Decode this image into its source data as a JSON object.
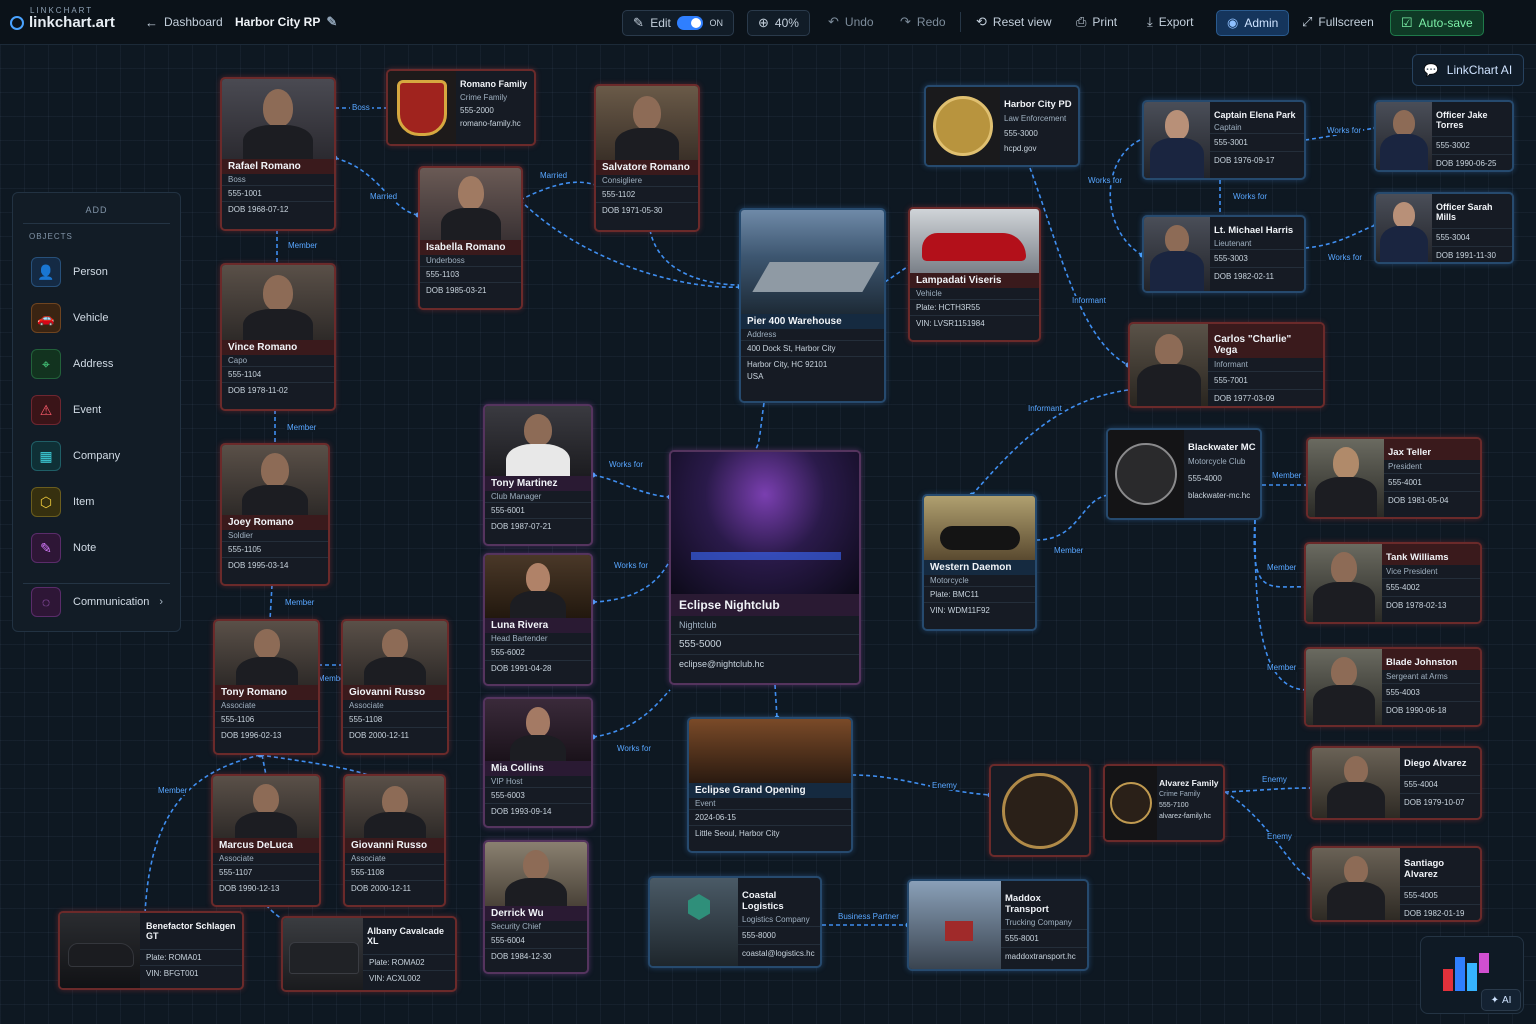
{
  "brand": {
    "small": "LINKCHART",
    "name": "linkchart.art"
  },
  "topbar": {
    "dashboard": "Dashboard",
    "project": "Harbor City RP",
    "edit": "Edit",
    "edit_state": "ON",
    "zoom": "40%",
    "undo": "Undo",
    "redo": "Redo",
    "reset": "Reset view",
    "print": "Print",
    "export": "Export",
    "admin": "Admin",
    "fullscreen": "Fullscreen",
    "autosave": "Auto-save"
  },
  "ai_button": "LinkChart AI",
  "ai_corner": "AI",
  "panel": {
    "title": "ADD",
    "section": "OBJECTS",
    "items": [
      "Person",
      "Vehicle",
      "Address",
      "Event",
      "Company",
      "Item",
      "Note",
      "Communication"
    ]
  },
  "colors": {
    "link": "#58a6ff",
    "red": "#6b2a2a",
    "blue": "#264a6e",
    "purple": "#55345e"
  },
  "links": [
    "Boss",
    "Married",
    "Married",
    "Member",
    "Member",
    "Member",
    "Member",
    "Member",
    "Works for",
    "Works for",
    "Works for",
    "Works for",
    "Works for",
    "Works for",
    "Informant",
    "Informant",
    "Member",
    "Member",
    "Member",
    "Member",
    "Enemy",
    "Enemy",
    "Enemy",
    "Business Partner"
  ],
  "cards": {
    "rafael": {
      "title": "Rafael Romano",
      "sub": "Boss",
      "phone": "555-1001",
      "dob": "DOB 1968-07-12"
    },
    "romanofam": {
      "title": "Romano Family",
      "sub": "Crime Family",
      "phone": "555-2000",
      "web": "romano-family.hc"
    },
    "salvatore": {
      "title": "Salvatore Romano",
      "sub": "Consigliere",
      "phone": "555-1102",
      "dob": "DOB 1971-05-30"
    },
    "isabella": {
      "title": "Isabella Romano",
      "sub": "Underboss",
      "phone": "555-1103",
      "dob": "DOB 1985-03-21"
    },
    "vince": {
      "title": "Vince Romano",
      "sub": "Capo",
      "phone": "555-1104",
      "dob": "DOB 1978-11-02"
    },
    "joey": {
      "title": "Joey Romano",
      "sub": "Soldier",
      "phone": "555-1105",
      "dob": "DOB 1995-03-14"
    },
    "tonyr": {
      "title": "Tony Romano",
      "sub": "Associate",
      "phone": "555-1106",
      "dob": "DOB 1996-02-13"
    },
    "giovanni1": {
      "title": "Giovanni Russo",
      "sub": "Associate",
      "phone": "555-1108",
      "dob": "DOB 2000-12-11"
    },
    "marcus": {
      "title": "Marcus DeLuca",
      "sub": "Associate",
      "phone": "555-1107",
      "dob": "DOB 1990-12-13"
    },
    "giovanni2": {
      "title": "Giovanni Russo",
      "sub": "Associate",
      "phone": "555-1108",
      "dob": "DOB 2000-12-11"
    },
    "benefactor": {
      "title": "Benefactor Schlagen GT",
      "plate": "Plate: ROMA01",
      "vin": "VIN: BFGT001"
    },
    "albany": {
      "title": "Albany Cavalcade XL",
      "plate": "Plate: ROMA02",
      "vin": "VIN: ACXL002"
    },
    "pier": {
      "title": "Pier 400 Warehouse",
      "sub": "Address",
      "l1": "400 Dock St, Harbor City",
      "l2": "Harbor City, HC 92101",
      "l3": "USA"
    },
    "lampadati": {
      "title": "Lampadati Viseris",
      "sub": "Vehicle",
      "plate": "Plate: HCTH3R55",
      "vin": "VIN: LVSR1151984"
    },
    "tonym": {
      "title": "Tony Martinez",
      "sub": "Club Manager",
      "phone": "555-6001",
      "dob": "DOB 1987-07-21"
    },
    "luna": {
      "title": "Luna Rivera",
      "sub": "Head Bartender",
      "phone": "555-6002",
      "dob": "DOB 1991-04-28"
    },
    "mia": {
      "title": "Mia Collins",
      "sub": "VIP Host",
      "phone": "555-6003",
      "dob": "DOB 1993-09-14"
    },
    "derrick": {
      "title": "Derrick Wu",
      "sub": "Security Chief",
      "phone": "555-6004",
      "dob": "DOB 1984-12-30"
    },
    "eclipse": {
      "title": "Eclipse Nightclub",
      "sub": "Nightclub",
      "phone": "555-5000",
      "web": "eclipse@nightclub.hc"
    },
    "grand": {
      "title": "Eclipse Grand Opening",
      "sub": "Event",
      "date": "2024-06-15",
      "place": "Little Seoul, Harbor City"
    },
    "coastal": {
      "title": "Coastal Logistics",
      "sub": "Logistics Company",
      "phone": "555-8000",
      "web": "coastal@logistics.hc"
    },
    "maddox": {
      "title": "Maddox Transport",
      "sub": "Trucking Company",
      "phone": "555-8001",
      "web": "maddoxtransport.hc"
    },
    "hcpd": {
      "title": "Harbor City PD",
      "sub": "Law Enforcement",
      "phone": "555-3000",
      "web": "hcpd.gov"
    },
    "park": {
      "title": "Captain Elena Park",
      "sub": "Captain",
      "phone": "555-3001",
      "dob": "DOB 1976-09-17"
    },
    "torres": {
      "title": "Officer Jake Torres",
      "phone": "555-3002",
      "dob": "DOB 1990-06-25"
    },
    "harris": {
      "title": "Lt. Michael Harris",
      "sub": "Lieutenant",
      "phone": "555-3003",
      "dob": "DOB 1982-02-11"
    },
    "mills": {
      "title": "Officer Sarah Mills",
      "phone": "555-3004",
      "dob": "DOB 1991-11-30"
    },
    "vega": {
      "title": "Carlos \"Charlie\" Vega",
      "sub": "Informant",
      "phone": "555-7001",
      "dob": "DOB 1977-03-09"
    },
    "blackwater": {
      "title": "Blackwater MC",
      "sub": "Motorcycle Club",
      "phone": "555-4000",
      "web": "blackwater-mc.hc"
    },
    "daemon": {
      "title": "Western Daemon",
      "sub": "Motorcycle",
      "plate": "Plate: BMC11",
      "vin": "VIN: WDM11F92"
    },
    "jax": {
      "title": "Jax Teller",
      "sub": "President",
      "phone": "555-4001",
      "dob": "DOB 1981-05-04"
    },
    "tank": {
      "title": "Tank Williams",
      "sub": "Vice President",
      "phone": "555-4002",
      "dob": "DOB 1978-02-13"
    },
    "blade": {
      "title": "Blade Johnston",
      "sub": "Sergeant at Arms",
      "phone": "555-4003",
      "dob": "DOB 1990-06-18"
    },
    "alvarezfam": {
      "title": "Alvarez Family",
      "sub": "Crime Family",
      "phone": "555-7100",
      "web": "alvarez-family.hc"
    },
    "diego": {
      "title": "Diego Alvarez",
      "phone": "555-4004",
      "dob": "DOB 1979-10-07"
    },
    "santiago": {
      "title": "Santiago Alvarez",
      "phone": "555-4005",
      "dob": "DOB 1982-01-19"
    }
  }
}
